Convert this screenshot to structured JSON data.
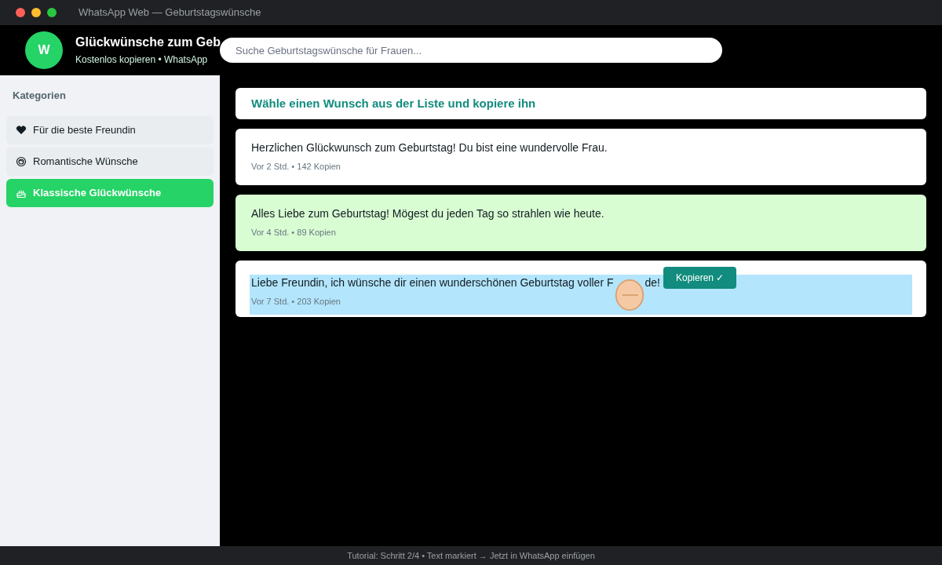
{
  "window": {
    "title": "WhatsApp Web — Geburtstagswünsche"
  },
  "header": {
    "avatar": "W",
    "title": "Glückwünsche zum Geb",
    "subtitle": "Kostenlos kopieren • WhatsApp"
  },
  "search": {
    "placeholder": "Suche Geburtstagswünsche für Frauen..."
  },
  "sidebar": {
    "heading": "Kategorien",
    "items": [
      {
        "kind": "heart",
        "label": "Für die beste Freundin",
        "selected": false
      },
      {
        "kind": "flower",
        "label": "Romantische Wünsche",
        "selected": false
      },
      {
        "kind": "cake",
        "label": "Klassische Glückwünsche",
        "selected": true
      }
    ]
  },
  "prompt": "Wähle einen Wunsch aus der Liste und kopiere ihn",
  "wishes": [
    {
      "text": "Herzlichen Glückwunsch zum Geburtstag! Du bist eine wundervolle Frau.",
      "meta": "Vor 2 Std. • 142 Kopien",
      "highlighted": false,
      "selected": false
    },
    {
      "text": "Alles Liebe zum Geburtstag! Mögest du jeden Tag so strahlen wie heute.",
      "meta": "Vor 4 Std. • 89 Kopien",
      "highlighted": true,
      "selected": false
    },
    {
      "text": "Liebe Freundin, ich wünsche dir einen wunderschönen Geburtstag voller F",
      "text_end": "de!",
      "meta": "Vor 7 Std. • 203 Kopien",
      "highlighted": false,
      "selected": true,
      "button": "Kopieren ✓"
    }
  ],
  "status_bar": "Tutorial: Schritt 2/4 • Text markiert → Jetzt in WhatsApp einfügen"
}
